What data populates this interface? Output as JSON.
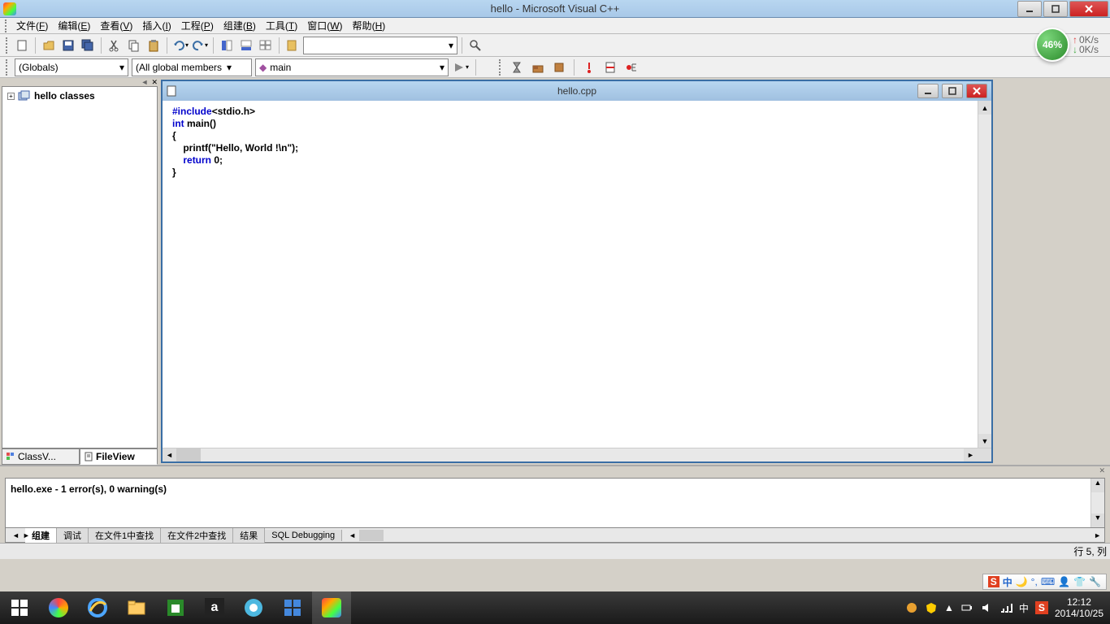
{
  "window": {
    "title": "hello - Microsoft Visual C++"
  },
  "menu": {
    "items": [
      {
        "label": "文件",
        "key": "F"
      },
      {
        "label": "编辑",
        "key": "E"
      },
      {
        "label": "查看",
        "key": "V"
      },
      {
        "label": "插入",
        "key": "I"
      },
      {
        "label": "工程",
        "key": "P"
      },
      {
        "label": "组建",
        "key": "B"
      },
      {
        "label": "工具",
        "key": "T"
      },
      {
        "label": "窗口",
        "key": "W"
      },
      {
        "label": "帮助",
        "key": "H"
      }
    ]
  },
  "toolbar2": {
    "globals": "(Globals)",
    "members": "(All global members",
    "function": "main"
  },
  "sidebar": {
    "tree_root": "hello classes",
    "tabs": {
      "classview": "ClassV...",
      "fileview": "FileView"
    }
  },
  "editor": {
    "filename": "hello.cpp",
    "code": {
      "l1a": "#include",
      "l1b": "<stdio.h>",
      "l2a": "int",
      "l2b": " main()",
      "l3": "{",
      "l4": "    printf(\"Hello, World !\\n\");",
      "l5a": "    ",
      "l5b": "return",
      "l5c": " 0;",
      "l6": "}"
    }
  },
  "output": {
    "message": "hello.exe - 1 error(s), 0 warning(s)",
    "tabs": [
      "组建",
      "调试",
      "在文件1中查找",
      "在文件2中查找",
      "结果",
      "SQL Debugging"
    ]
  },
  "statusbar": {
    "pos": "行 5, 列"
  },
  "netbadge": {
    "percent": "46%",
    "up": "0K/s",
    "down": "0K/s"
  },
  "systray": {
    "ime1": "中",
    "ime2": "S"
  },
  "taskbar": {
    "time": "12:12",
    "date": "2014/10/25"
  }
}
